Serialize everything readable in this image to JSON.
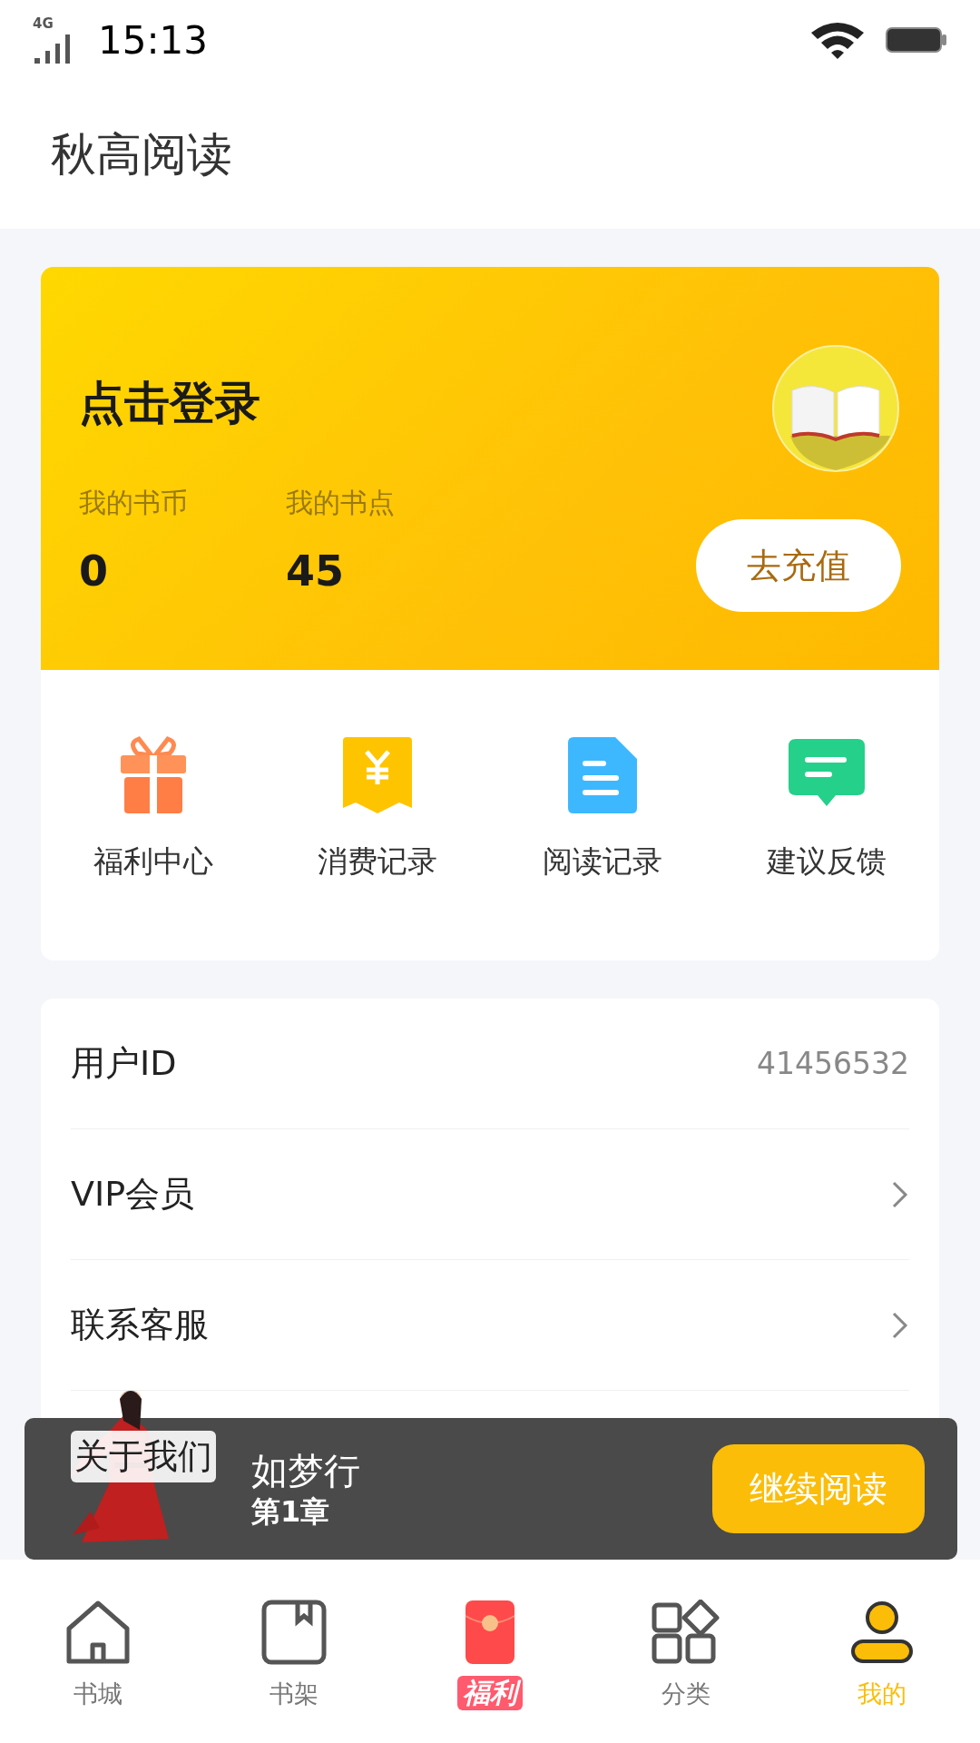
{
  "status_bar": {
    "network": "4G",
    "time": "15:13"
  },
  "header": {
    "title": "秋高阅读"
  },
  "account_card": {
    "login_label": "点击登录",
    "stats": [
      {
        "label": "我的书币",
        "value": "0"
      },
      {
        "label": "我的书点",
        "value": "45"
      }
    ],
    "recharge_button": "去充值"
  },
  "shortcuts": [
    {
      "label": "福利中心",
      "kind": "gift"
    },
    {
      "label": "消费记录",
      "kind": "receipt"
    },
    {
      "label": "阅读记录",
      "kind": "document"
    },
    {
      "label": "建议反馈",
      "kind": "message"
    }
  ],
  "settings": [
    {
      "label": "用户ID",
      "value": "41456532",
      "kind": "value"
    },
    {
      "label": "VIP会员",
      "kind": "link"
    },
    {
      "label": "联系客服",
      "kind": "link"
    },
    {
      "label": "关于我们",
      "kind": "plain"
    }
  ],
  "reading_bar": {
    "book_title": "如梦行",
    "chapter": "第1章",
    "continue_button": "继续阅读"
  },
  "tab_bar": [
    {
      "label": "书城",
      "kind": "home",
      "selected": false
    },
    {
      "label": "书架",
      "kind": "shelf",
      "selected": false
    },
    {
      "label": "福利",
      "kind": "promo",
      "selected": false
    },
    {
      "label": "分类",
      "kind": "category",
      "selected": false
    },
    {
      "label": "我的",
      "kind": "profile",
      "selected": true
    }
  ]
}
